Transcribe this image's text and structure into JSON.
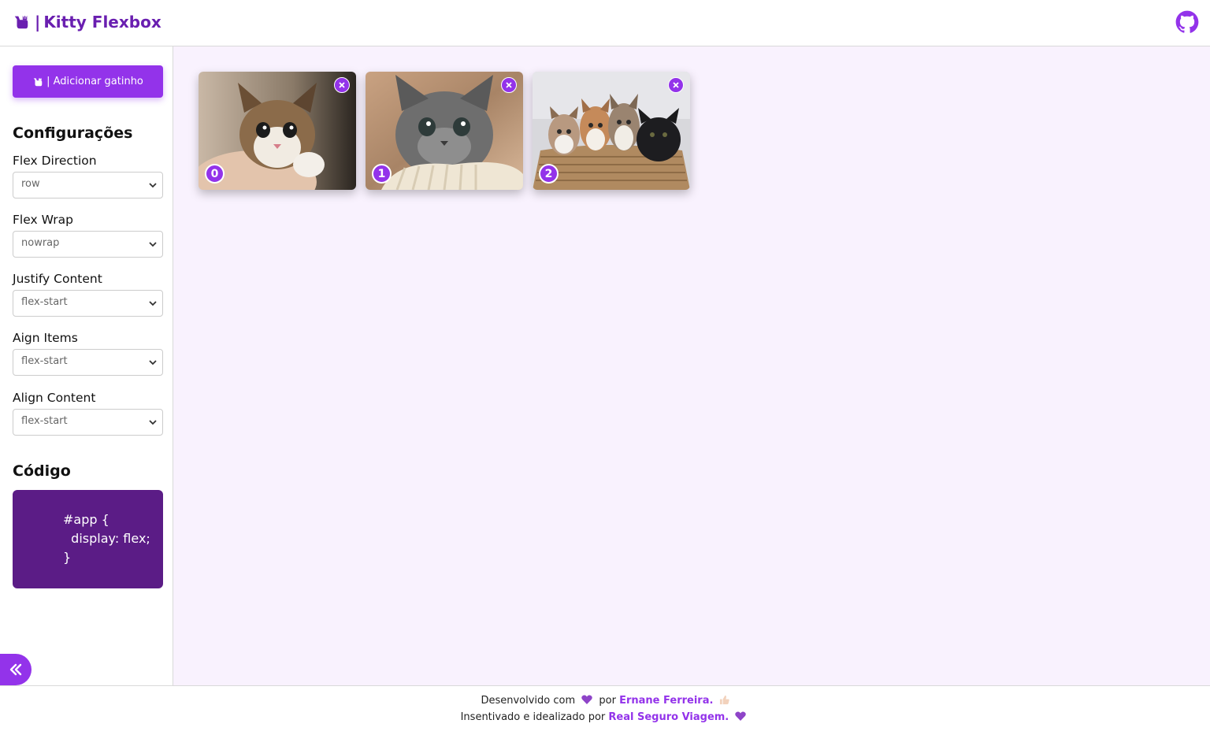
{
  "header": {
    "logo_icon": "cat-icon",
    "separator": "|",
    "title": "Kitty Flexbox",
    "github_icon": "github-icon"
  },
  "sidebar": {
    "add_button": {
      "icon": "cat-icon",
      "label": "| Adicionar gatinho"
    },
    "settings_heading": "Configurações",
    "fields": [
      {
        "label": "Flex Direction",
        "value": "row"
      },
      {
        "label": "Flex Wrap",
        "value": "nowrap"
      },
      {
        "label": "Justify Content",
        "value": "flex-start"
      },
      {
        "label": "Aign Items",
        "value": "flex-start"
      },
      {
        "label": "Align Content",
        "value": "flex-start"
      }
    ],
    "code_heading": "Código",
    "code_lines": [
      "#app {",
      "  display: flex;",
      "}"
    ],
    "collapse_icon": "double-chevron-left-icon"
  },
  "main": {
    "cards": [
      {
        "index": "0",
        "alt": "kitten held in hand"
      },
      {
        "index": "1",
        "alt": "grey kitten on blanket"
      },
      {
        "index": "2",
        "alt": "four kittens in a basket"
      }
    ]
  },
  "footer": {
    "line1_prefix": "Desenvolvido com",
    "line1_mid": "por",
    "author": "Ernane Ferreira.",
    "line2_prefix": "Insentivado e idealizado por",
    "sponsor": "Real Seguro Viagem."
  },
  "colors": {
    "accent": "#9333ea",
    "brand_text": "#6a1fb0",
    "code_bg": "#5b1c86",
    "main_bg": "#f9f2fe"
  }
}
